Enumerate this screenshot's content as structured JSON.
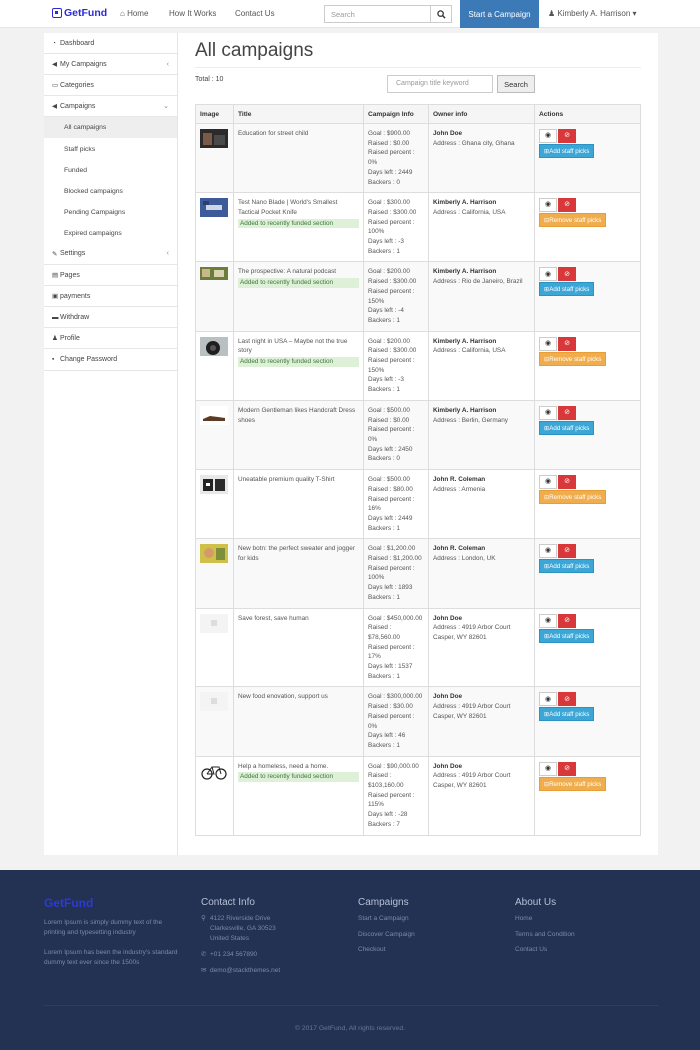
{
  "header": {
    "brand": "GetFund",
    "nav": [
      "Home",
      "How It Works",
      "Contact Us"
    ],
    "search_placeholder": "Search",
    "start_button": "Start a Campaign",
    "user": "Kimberly A. Harrison"
  },
  "sidebar": {
    "items": [
      {
        "label": "Dashboard",
        "icon": "dashboard-icon"
      },
      {
        "label": "My Campaigns",
        "icon": "bullhorn-icon",
        "chevron": "‹"
      },
      {
        "label": "Categories",
        "icon": "folder-icon"
      },
      {
        "label": "Campaigns",
        "icon": "bullhorn-icon",
        "chevron": "⌄"
      },
      {
        "label": "All campaigns",
        "sub": true,
        "active": true
      },
      {
        "label": "Staff picks",
        "sub": true
      },
      {
        "label": "Funded",
        "sub": true
      },
      {
        "label": "Blocked campaigns",
        "sub": true
      },
      {
        "label": "Pending Campaigns",
        "sub": true
      },
      {
        "label": "Expired campaigns",
        "sub": true
      },
      {
        "label": "Settings",
        "icon": "wrench-icon",
        "chevron": "‹"
      },
      {
        "label": "Pages",
        "icon": "file-icon"
      },
      {
        "label": "payments",
        "icon": "money-icon"
      },
      {
        "label": "Withdraw",
        "icon": "credit-card-icon"
      },
      {
        "label": "Profile",
        "icon": "user-icon"
      },
      {
        "label": "Change Password",
        "icon": "lock-icon"
      }
    ]
  },
  "main": {
    "title": "All campaigns",
    "total": "Total : 10",
    "keyword_placeholder": "Campaign title keyword",
    "search_button": "Search",
    "columns": [
      "Image",
      "Title",
      "Campaign Info",
      "Owner info",
      "Actions"
    ],
    "rows": [
      {
        "title": "Education for street child",
        "tag": "",
        "goal": "Goal : $900.00",
        "raised": "Raised : $0.00",
        "pct": "Raised percent : 0%",
        "days": "Days left : 2449",
        "backers": "Backers : 0",
        "owner": "John Doe",
        "address": "Address : Ghana city, Ghana",
        "action": "Add staff picks",
        "image": "street-child-photo"
      },
      {
        "title": "Test Nano Blade | World's Smallest Tactical Pocket Knife",
        "tag": "Added to recently funded section",
        "goal": "Goal : $300.00",
        "raised": "Raised : $300.00",
        "pct": "Raised percent : 100%",
        "days": "Days left : -3",
        "backers": "Backers : 1",
        "owner": "Kimberly A. Harrison",
        "address": "Address : California, USA",
        "action": "Remove staff picks",
        "image": "knife-photo"
      },
      {
        "title": "The prospective: A natural podcast",
        "tag": "Added to recently funded section",
        "goal": "Goal : $200.00",
        "raised": "Raised : $300.00",
        "pct": "Raised percent : 150%",
        "days": "Days left : -4",
        "backers": "Backers : 1",
        "owner": "Kimberly A. Harrison",
        "address": "Address : Rio de Janeiro, Brazil",
        "action": "Add staff picks",
        "image": "podcast-photo"
      },
      {
        "title": "Last night in USA – Maybe not the true story",
        "tag": "Added to recently funded section",
        "goal": "Goal : $200.00",
        "raised": "Raised : $300.00",
        "pct": "Raised percent : 150%",
        "days": "Days left : -3",
        "backers": "Backers : 1",
        "owner": "Kimberly A. Harrison",
        "address": "Address : California, USA",
        "action": "Remove staff picks",
        "image": "camera-lens-photo"
      },
      {
        "title": "Modern Gentleman likes Handcraft Dress shoes",
        "tag": "",
        "goal": "Goal : $500.00",
        "raised": "Raised : $0.00",
        "pct": "Raised percent : 0%",
        "days": "Days left : 2450",
        "backers": "Backers : 0",
        "owner": "Kimberly A. Harrison",
        "address": "Address : Berlin, Germany",
        "action": "Add staff picks",
        "image": "shoe-photo"
      },
      {
        "title": "Uneatable premium quality T-Shirt",
        "tag": "",
        "goal": "Goal : $500.00",
        "raised": "Raised : $80.00",
        "pct": "Raised percent : 16%",
        "days": "Days left : 2449",
        "backers": "Backers : 1",
        "owner": "John R. Coleman",
        "address": "Address : Armenia",
        "action": "Remove staff picks",
        "image": "tshirt-photo"
      },
      {
        "title": "New botn: the perfect sweater and jogger for kids",
        "tag": "",
        "goal": "Goal : $1,200.00",
        "raised": "Raised : $1,200.00",
        "pct": "Raised percent : 100%",
        "days": "Days left : 1893",
        "backers": "Backers : 1",
        "owner": "John R. Coleman",
        "address": "Address : London, UK",
        "action": "Add staff picks",
        "image": "kids-photo"
      },
      {
        "title": "Save forest, save human",
        "tag": "",
        "goal": "Goal : $450,000.00",
        "raised": "Raised : $78,560.00",
        "pct": "Raised percent : 17%",
        "days": "Days left : 1537",
        "backers": "Backers : 1",
        "owner": "John Doe",
        "address": "Address : 4919 Arbor Court Casper, WY 82601",
        "action": "Add staff picks",
        "image": "placeholder-image"
      },
      {
        "title": "New food enovation, support us",
        "tag": "",
        "goal": "Goal : $300,000.00",
        "raised": "Raised : $30.00",
        "pct": "Raised percent : 0%",
        "days": "Days left : 46",
        "backers": "Backers : 1",
        "owner": "John Doe",
        "address": "Address : 4919 Arbor Court Casper, WY 82601",
        "action": "Add staff picks",
        "image": "placeholder-image"
      },
      {
        "title": "Help a homeless, need a home.",
        "tag": "Added to recently funded section",
        "goal": "Goal : $90,000.00",
        "raised": "Raised : $103,160.00",
        "pct": "Raised percent : 115%",
        "days": "Days left : -28",
        "backers": "Backers : 7",
        "owner": "John Doe",
        "address": "Address : 4919 Arbor Court Casper, WY 82601",
        "action": "Remove staff picks",
        "image": "bicycle-photo"
      }
    ]
  },
  "footer": {
    "brand": "GetFund",
    "about1": "Lorem Ipsum is simply dummy text of the printing and typesetting industry",
    "about2": "Lorem Ipsum has been the industry's standard dummy text ever since the 1500s",
    "contact_title": "Contact Info",
    "address": "4122 Riverside Drive Clarkesville, GA 30523 United States",
    "phone": "+01 234 567890",
    "email": "demo@stackthemes.net",
    "campaigns_title": "Campaigns",
    "campaigns_links": [
      "Start a Campaign",
      "Discover Campaign",
      "Checkout"
    ],
    "about_title": "About Us",
    "about_links": [
      "Home",
      "Terms and Condition",
      "Contact Us"
    ],
    "copyright": "© 2017 GetFund, All rights reserved."
  },
  "colors": {
    "brand": "#2b2bd6",
    "primary": "#3b79b7",
    "info": "#3ca6d6",
    "warning": "#f0ad4e",
    "danger": "#d9383a",
    "footer": "#233152"
  }
}
